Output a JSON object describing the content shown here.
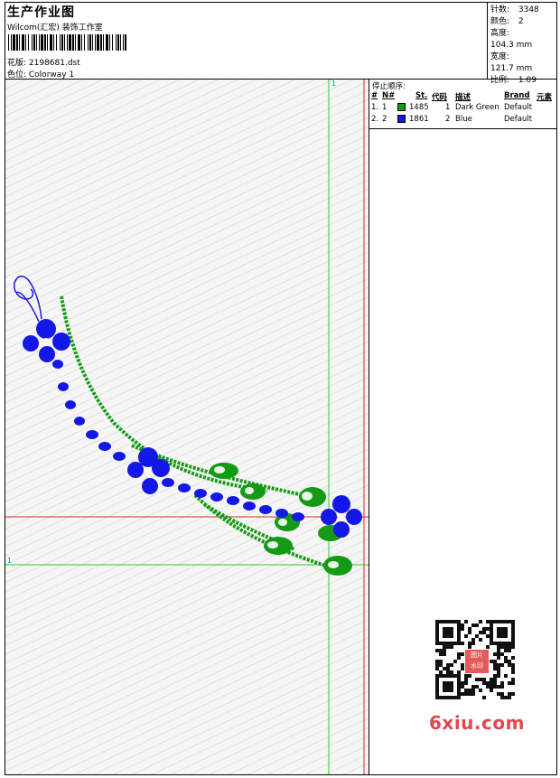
{
  "header": {
    "title": "生产作业图",
    "subtitle": "Wilcom(汇宏) 装饰工作室",
    "design_label": "花版: 2198681.dst",
    "colorway_label": "色位: Colorway 1"
  },
  "stats": [
    {
      "key": "针数:",
      "value": "3348"
    },
    {
      "key": "颜色:",
      "value": "2"
    },
    {
      "key": "高度:",
      "value": "104.3 mm"
    },
    {
      "key": "宽度:",
      "value": "121.7 mm"
    },
    {
      "key": "比例:",
      "value": "1.09"
    }
  ],
  "stop_list": {
    "title": "停止顺序:",
    "headers": [
      "#",
      "N#",
      "St.",
      "代码",
      "描述",
      "Brand",
      "元素"
    ],
    "rows": [
      {
        "idx": "1.",
        "n": "1",
        "stitches": "1485",
        "code": "1",
        "description": "Dark Green",
        "brand": "Default",
        "color": "#159a15"
      },
      {
        "idx": "2.",
        "n": "2",
        "stitches": "1861",
        "code": "2",
        "description": "Blue",
        "brand": "Default",
        "color": "#1418e6"
      }
    ]
  },
  "design_markers": {
    "top_marker": "1",
    "left_marker": "1"
  },
  "watermark": {
    "site": "6xiu.com",
    "seal_text": "图片水印"
  },
  "colors": {
    "green": "#159a15",
    "blue": "#1418e6",
    "guide_green": "#2ecc2e",
    "guide_red": "#e0281f"
  }
}
